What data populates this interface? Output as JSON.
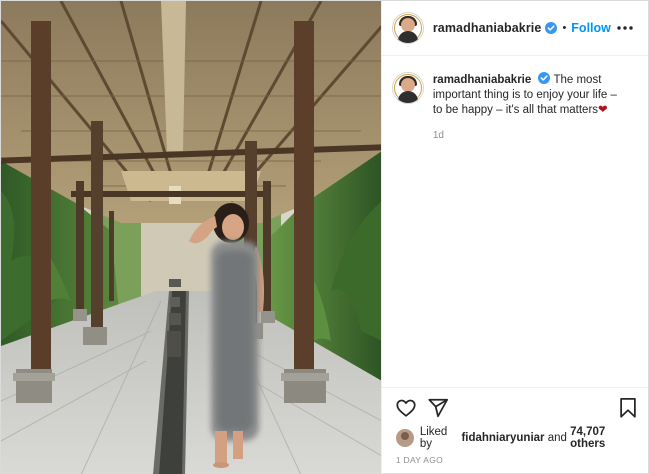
{
  "post": {
    "username": "ramadhaniabakrie",
    "follow_label": "Follow",
    "separator": "•",
    "caption": {
      "username": "ramadhaniabakrie",
      "text": "The most important thing is to enjoy your life – to be happy – it's all that matters",
      "emoji": "❤"
    },
    "caption_time": "1d",
    "likes": {
      "prefix": "Liked by",
      "user": "fidahniaryuniar",
      "middle": "and",
      "count": "74,707 others"
    },
    "timestamp": "1 DAY AGO"
  },
  "icons": {
    "verified": "verified-badge-icon",
    "more": "more-options-icon",
    "like": "heart-icon",
    "share": "paper-plane-icon",
    "save": "bookmark-icon"
  },
  "colors": {
    "follow": "#0095f6",
    "verified": "#3897f0",
    "muted": "#8e8e8e",
    "text": "#262626",
    "emoji_heart": "#b3121b"
  }
}
